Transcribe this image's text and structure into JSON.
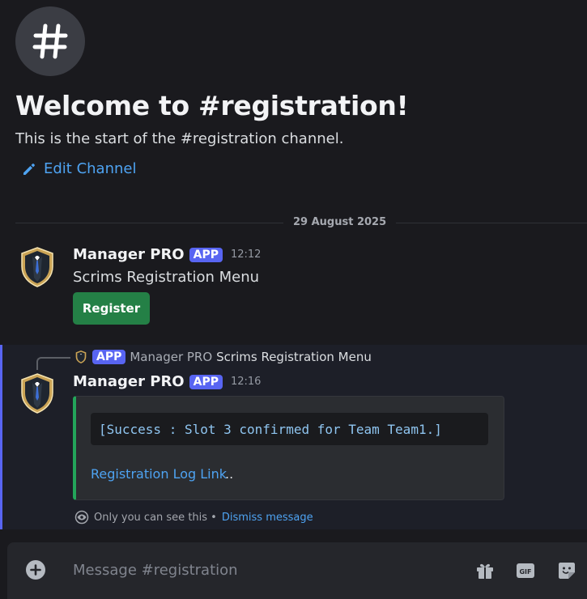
{
  "channel": {
    "welcome_title": "Welcome to #registration!",
    "start_text": "This is the start of the #registration channel.",
    "edit_label": "Edit Channel"
  },
  "date_divider": "29 August 2025",
  "messages": [
    {
      "author": "Manager PRO",
      "badge": "APP",
      "time": "12:12",
      "text": "Scrims Registration Menu",
      "button_label": "Register"
    },
    {
      "reply": {
        "badge": "APP",
        "author": "Manager PRO",
        "text": "Scrims Registration Menu"
      },
      "author": "Manager PRO",
      "badge": "APP",
      "time": "12:16",
      "embed": {
        "code": "[Success : Slot 3 confirmed for Team Team1.]",
        "link": "Registration Log Link",
        "link_tail": ".."
      },
      "ephemeral_text": "Only you can see this •",
      "dismiss_label": "Dismiss message"
    }
  ],
  "composer": {
    "placeholder": "Message #registration"
  },
  "colors": {
    "accent": "#5865f2",
    "success": "#23a55a",
    "link": "#4ea3f2",
    "button_green": "#248046"
  }
}
